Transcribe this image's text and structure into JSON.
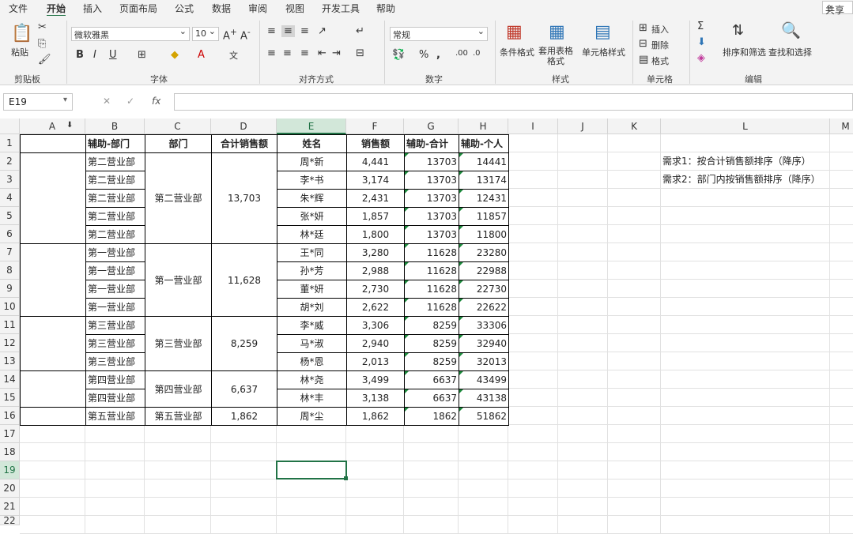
{
  "menu": {
    "items": [
      "文件",
      "开始",
      "插入",
      "页面布局",
      "公式",
      "数据",
      "审阅",
      "视图",
      "开发工具",
      "帮助"
    ],
    "active_index": 1,
    "share": "共享"
  },
  "ribbon": {
    "clipboard": {
      "paste": "粘贴",
      "label": "剪贴板"
    },
    "font": {
      "name": "微软雅黑",
      "size": "10",
      "label": "字体",
      "bold": "B",
      "italic": "I",
      "underline": "U"
    },
    "align": {
      "label": "对齐方式"
    },
    "number": {
      "format": "常规",
      "label": "数字",
      "percent": "%"
    },
    "styles": {
      "cond": "条件格式",
      "table": "套用表格格式",
      "cell": "单元格样式",
      "label": "样式"
    },
    "cells": {
      "insert": "插入",
      "delete": "删除",
      "format": "格式",
      "label": "单元格"
    },
    "editing": {
      "sort": "排序和筛选",
      "find": "查找和选择",
      "label": "编辑"
    }
  },
  "formula_bar": {
    "name_box": "E19",
    "fx": "fx",
    "value": ""
  },
  "columns": [
    "A",
    "B",
    "C",
    "D",
    "E",
    "F",
    "G",
    "H",
    "I",
    "J",
    "K",
    "L",
    "M"
  ],
  "selected_column": "E",
  "selected_row": 19,
  "rows": [
    1,
    2,
    3,
    4,
    5,
    6,
    7,
    8,
    9,
    10,
    11,
    12,
    13,
    14,
    15,
    16,
    17,
    18,
    19,
    20,
    21,
    22
  ],
  "headers": {
    "b": "辅助-部门",
    "c": "部门",
    "d": "合计销售额",
    "e": "姓名",
    "f": "销售额",
    "g": "辅助-合计",
    "h": "辅助-个人"
  },
  "table": [
    {
      "b": "第二营业部",
      "e": "周*新",
      "f": "4,441",
      "g": "13703",
      "h": "14441"
    },
    {
      "b": "第二营业部",
      "e": "李*书",
      "f": "3,174",
      "g": "13703",
      "h": "13174"
    },
    {
      "b": "第二营业部",
      "e": "朱*辉",
      "f": "2,431",
      "g": "13703",
      "h": "12431"
    },
    {
      "b": "第二营业部",
      "e": "张*妍",
      "f": "1,857",
      "g": "13703",
      "h": "11857"
    },
    {
      "b": "第二营业部",
      "e": "林*廷",
      "f": "1,800",
      "g": "13703",
      "h": "11800"
    },
    {
      "b": "第一营业部",
      "e": "王*同",
      "f": "3,280",
      "g": "11628",
      "h": "23280"
    },
    {
      "b": "第一营业部",
      "e": "孙*芳",
      "f": "2,988",
      "g": "11628",
      "h": "22988"
    },
    {
      "b": "第一营业部",
      "e": "董*妍",
      "f": "2,730",
      "g": "11628",
      "h": "22730"
    },
    {
      "b": "第一营业部",
      "e": "胡*刘",
      "f": "2,622",
      "g": "11628",
      "h": "22622"
    },
    {
      "b": "第三营业部",
      "e": "李*威",
      "f": "3,306",
      "g": "8259",
      "h": "33306"
    },
    {
      "b": "第三营业部",
      "e": "马*淑",
      "f": "2,940",
      "g": "8259",
      "h": "32940"
    },
    {
      "b": "第三营业部",
      "e": "杨*恩",
      "f": "2,013",
      "g": "8259",
      "h": "32013"
    },
    {
      "b": "第四营业部",
      "e": "林*尧",
      "f": "3,499",
      "g": "6637",
      "h": "43499"
    },
    {
      "b": "第四营业部",
      "e": "林*丰",
      "f": "3,138",
      "g": "6637",
      "h": "43138"
    },
    {
      "b": "第五营业部",
      "e": "周*尘",
      "f": "1,862",
      "g": "1862",
      "h": "51862"
    }
  ],
  "groups": [
    {
      "c": "第二营业部",
      "d": "13,703"
    },
    {
      "c": "第一营业部",
      "d": "11,628"
    },
    {
      "c": "第三营业部",
      "d": "8,259"
    },
    {
      "c": "第四营业部",
      "d": "6,637"
    },
    {
      "c": "第五营业部",
      "d": "1,862"
    }
  ],
  "notes": [
    "需求1：按合计销售额排序（降序）",
    "需求2：部门内按销售额排序（降序）"
  ]
}
